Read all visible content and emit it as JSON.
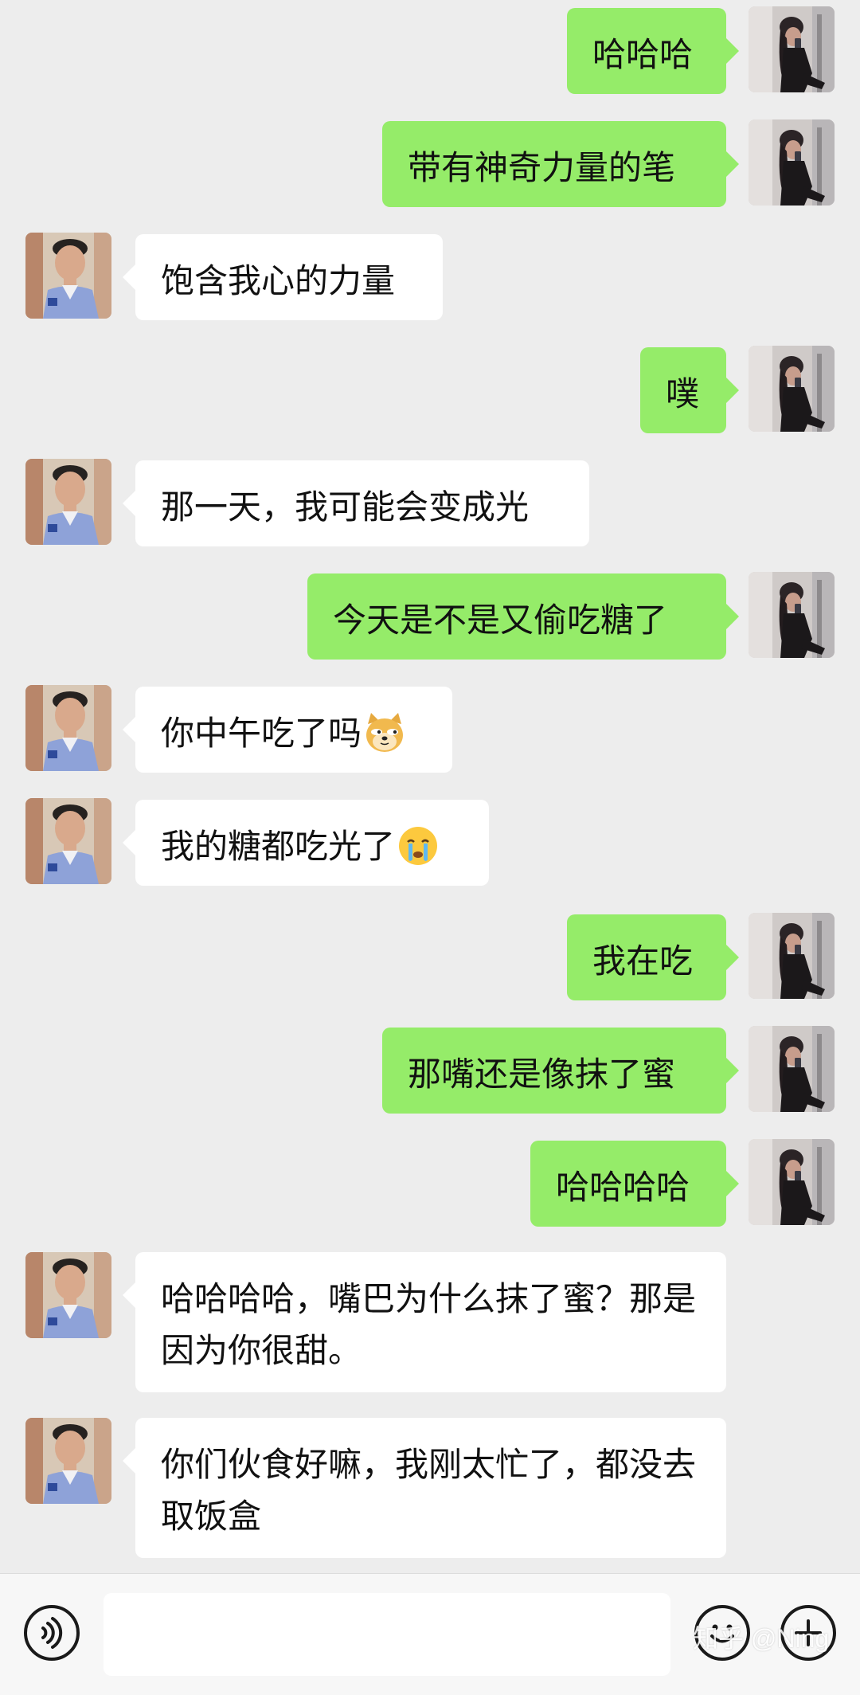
{
  "conversation": {
    "messages": [
      {
        "sender": "me",
        "text": "哈哈哈"
      },
      {
        "sender": "me",
        "text": "带有神奇力量的笔"
      },
      {
        "sender": "them",
        "text": "饱含我心的力量"
      },
      {
        "sender": "me",
        "text": "噗"
      },
      {
        "sender": "them",
        "text": "那一天，我可能会变成光"
      },
      {
        "sender": "me",
        "text": "今天是不是又偷吃糖了"
      },
      {
        "sender": "them",
        "text": "你中午吃了吗",
        "emoji": "doge-emoji"
      },
      {
        "sender": "them",
        "text": "我的糖都吃光了",
        "emoji": "crying-face-emoji"
      },
      {
        "sender": "me",
        "text": "我在吃"
      },
      {
        "sender": "me",
        "text": "那嘴还是像抹了蜜"
      },
      {
        "sender": "me",
        "text": "哈哈哈哈"
      },
      {
        "sender": "them",
        "text": "哈哈哈哈，嘴巴为什么抹了蜜？那是因为你很甜。"
      },
      {
        "sender": "them",
        "text": "你们伙食好嘛，我刚太忙了，都没去取饭盒"
      }
    ]
  },
  "colors": {
    "background": "#ededed",
    "my_bubble": "#95ec69",
    "their_bubble": "#ffffff"
  },
  "input_bar": {
    "value": "",
    "icons": [
      "voice-icon",
      "emoji-face-icon",
      "plus-icon"
    ]
  },
  "watermark": {
    "text": "知乎 @Ning"
  }
}
